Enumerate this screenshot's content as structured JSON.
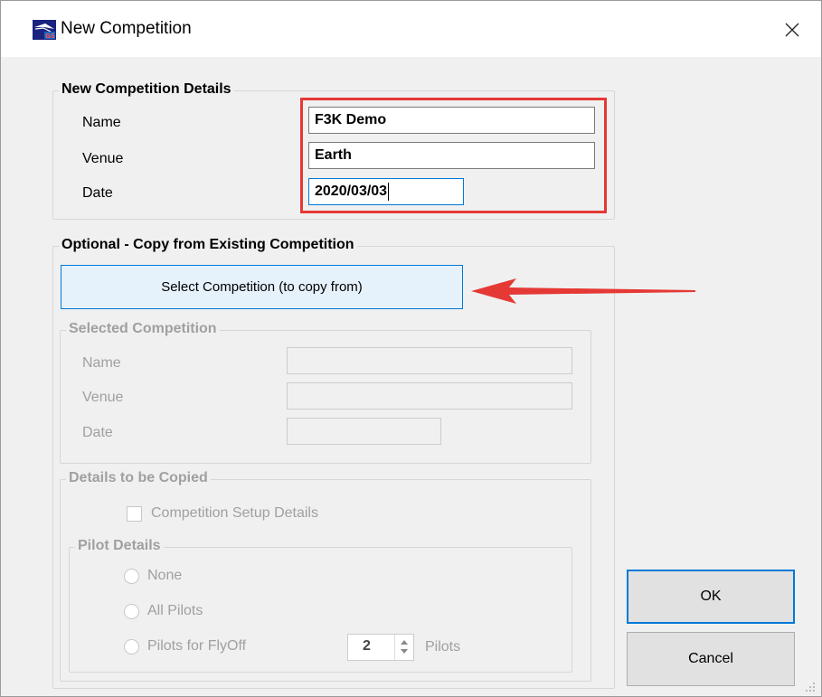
{
  "window": {
    "title": "New Competition",
    "icon": "gliderscore-app-icon",
    "close_icon": "close-icon"
  },
  "new_details": {
    "legend": "New Competition Details",
    "name_label": "Name",
    "name_value": "F3K Demo",
    "venue_label": "Venue",
    "venue_value": "Earth",
    "date_label": "Date",
    "date_value": "2020/03/03"
  },
  "optional": {
    "legend": "Optional - Copy from Existing Competition",
    "select_button_label": "Select Competition (to copy from)"
  },
  "selected": {
    "legend": "Selected Competition",
    "name_label": "Name",
    "name_value": "",
    "venue_label": "Venue",
    "venue_value": "",
    "date_label": "Date",
    "date_value": ""
  },
  "copy_details": {
    "legend": "Details to be Copied",
    "setup_checkbox_label": "Competition Setup Details",
    "setup_checked": false,
    "pilot_details": {
      "legend": "Pilot Details",
      "options": [
        {
          "label": "None",
          "selected": false
        },
        {
          "label": "All Pilots",
          "selected": false
        },
        {
          "label": "Pilots for FlyOff",
          "selected": false
        }
      ],
      "flyoff_count": "2",
      "flyoff_suffix": "Pilots"
    }
  },
  "buttons": {
    "ok_label": "OK",
    "cancel_label": "Cancel"
  },
  "colors": {
    "annotation_red": "#e53935",
    "focus_blue": "#0078d7",
    "disabled_text": "#a0a0a0"
  }
}
